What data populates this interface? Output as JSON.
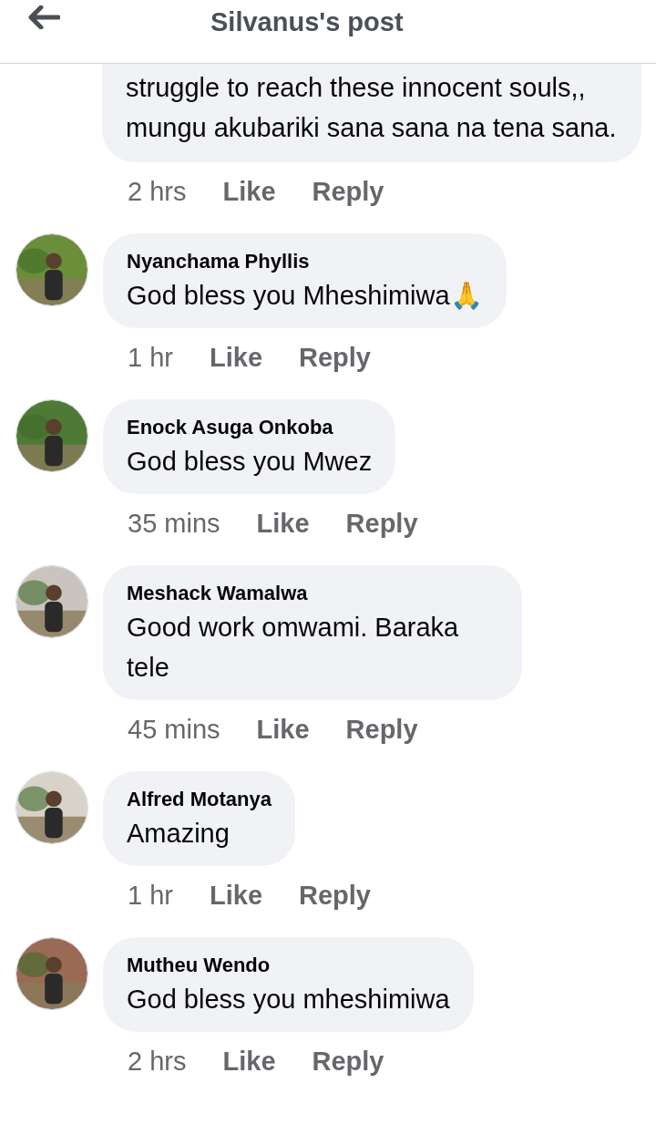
{
  "header": {
    "title": "Silvanus's post"
  },
  "first_comment": {
    "text": "struggle to reach these innocent souls,, mungu akubariki sana sana na tena sana.",
    "time": "2 hrs",
    "like": "Like",
    "reply": "Reply"
  },
  "comments": [
    {
      "name": "Nyanchama Phyllis",
      "text": "God bless you Mheshimiwa🙏",
      "time": "1 hr",
      "like": "Like",
      "reply": "Reply"
    },
    {
      "name": "Enock Asuga Onkoba",
      "text": "God bless you Mwez",
      "time": "35 mins",
      "like": "Like",
      "reply": "Reply"
    },
    {
      "name": "Meshack Wamalwa",
      "text": "Good work omwami. Baraka tele",
      "time": "45 mins",
      "like": "Like",
      "reply": "Reply"
    },
    {
      "name": "Alfred Motanya",
      "text": "Amazing",
      "time": "1 hr",
      "like": "Like",
      "reply": "Reply"
    },
    {
      "name": "Mutheu Wendo",
      "text": "God bless you mheshimiwa",
      "time": "2 hrs",
      "like": "Like",
      "reply": "Reply"
    }
  ]
}
